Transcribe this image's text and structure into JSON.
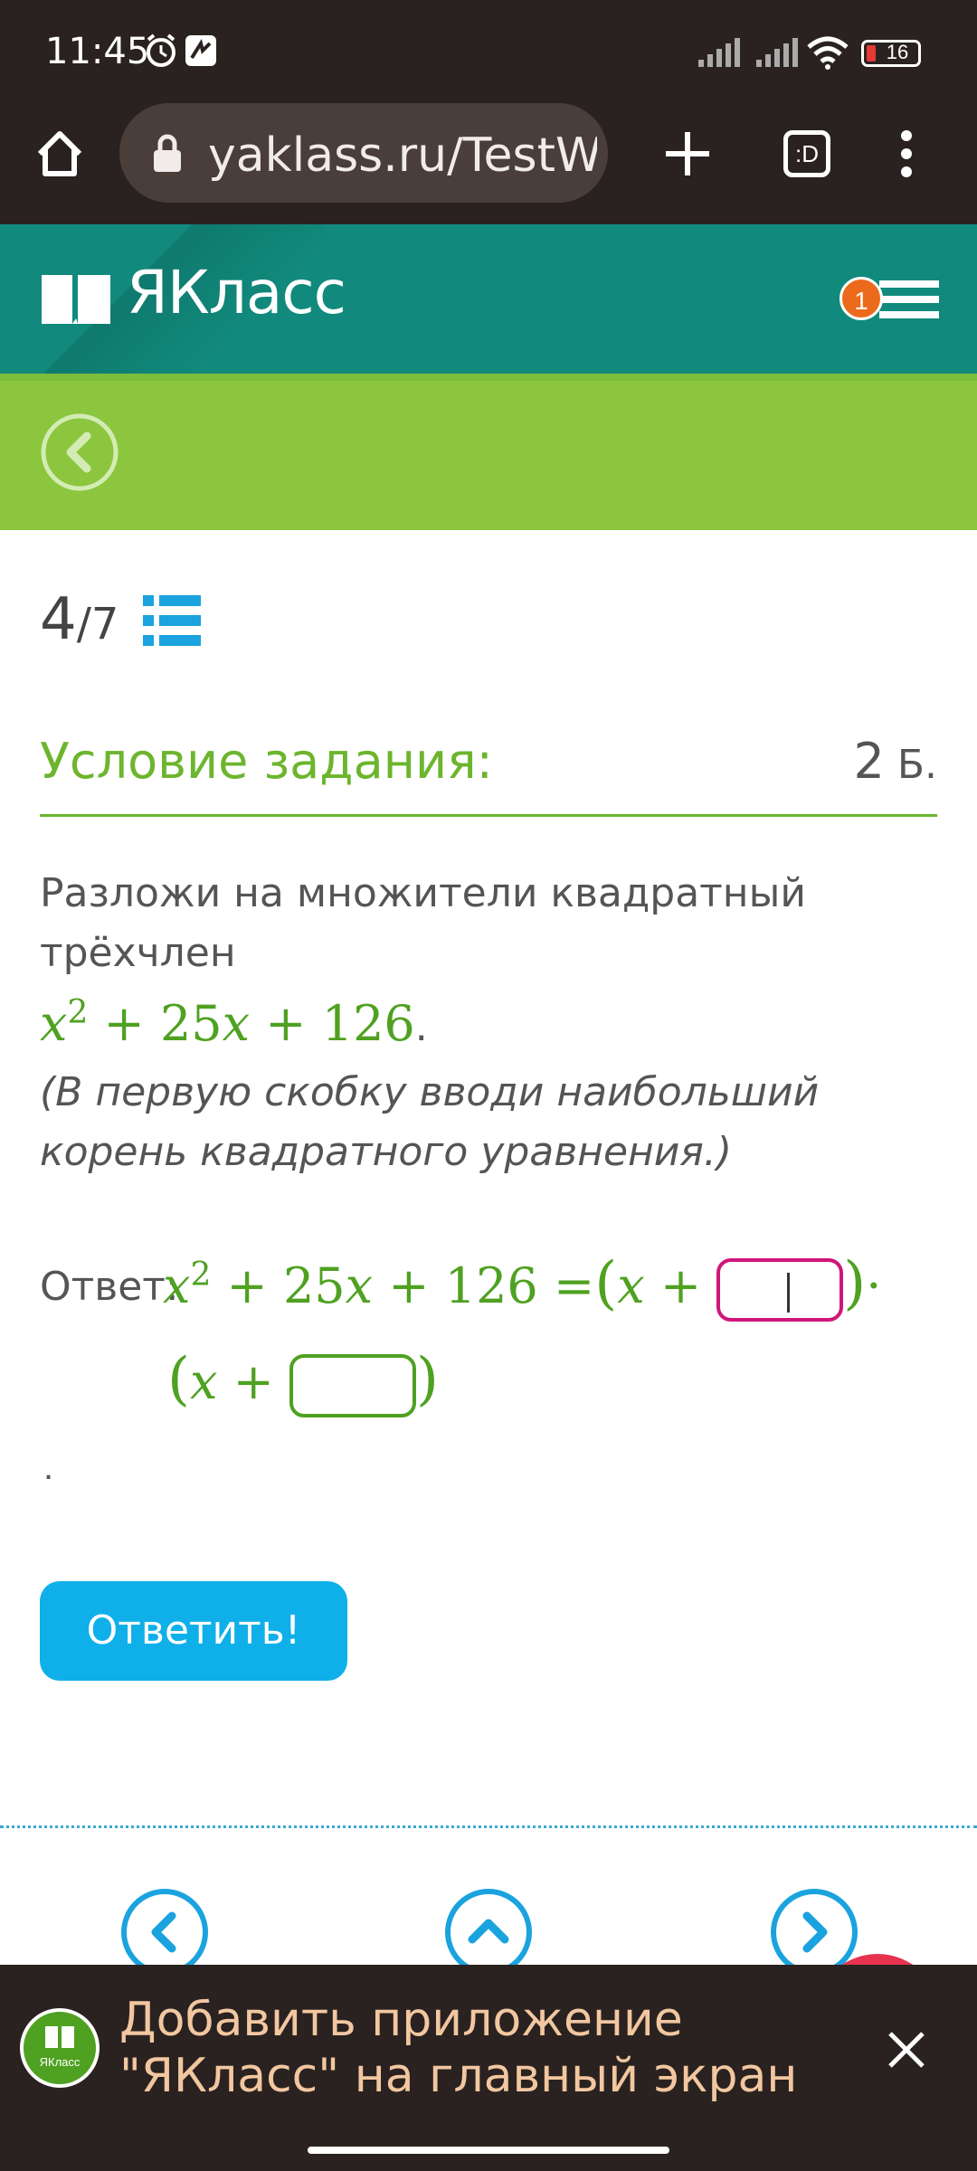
{
  "status_bar": {
    "time": "11:45",
    "battery": "16"
  },
  "browser": {
    "url": "yaklass.ru/TestW",
    "tabs_icon": ":D"
  },
  "site": {
    "logo": "ЯКласс",
    "notifications": "1"
  },
  "progress": {
    "current": "4",
    "total": "/7"
  },
  "task": {
    "title": "Условие задания:",
    "points": "2",
    "points_unit": " Б.",
    "text": "Разложи на множители квадратный трёхчлен",
    "expression": {
      "coef": "25",
      "const": "126"
    },
    "hint": "(В первую скобку вводи наибольший корень квадратного уравнения.)"
  },
  "answer": {
    "label": "Ответ:",
    "root1": "",
    "root2": "",
    "period": "."
  },
  "submit_label": "Ответить!",
  "banner": {
    "logo_text": "ЯКласс",
    "text_line1": "Добавить приложение",
    "text_line2": "\"ЯКласс\" на главный экран"
  },
  "colors": {
    "header": "#118a7d",
    "nav": "#8cc63f",
    "accent": "#6cb52d",
    "button": "#0fb0ea",
    "active_input": "#d0167a"
  }
}
